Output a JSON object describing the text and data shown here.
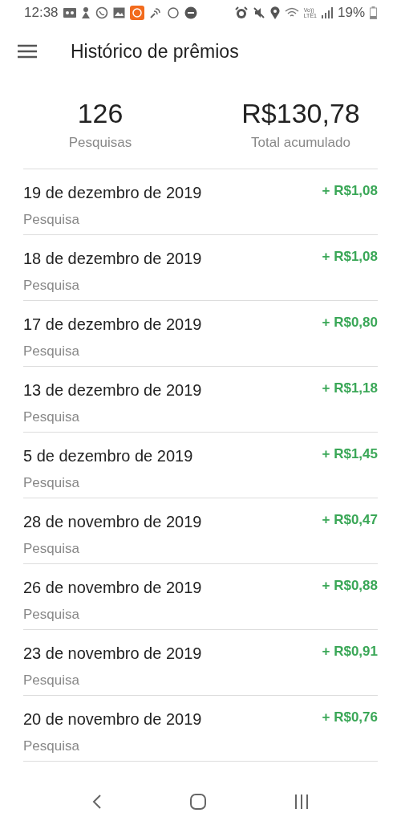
{
  "status_bar": {
    "time": "12:38",
    "volte": "Vo))",
    "network": "LTE1",
    "battery": "19%"
  },
  "header": {
    "title": "Histórico de prêmios"
  },
  "summary": [
    {
      "value": "126",
      "label": "Pesquisas"
    },
    {
      "value": "R$130,78",
      "label": "Total acumulado"
    }
  ],
  "rewards": [
    {
      "date": "19 de dezembro de 2019",
      "type": "Pesquisa",
      "amount": "+ R$1,08"
    },
    {
      "date": "18 de dezembro de 2019",
      "type": "Pesquisa",
      "amount": "+ R$1,08"
    },
    {
      "date": "17 de dezembro de 2019",
      "type": "Pesquisa",
      "amount": "+ R$0,80"
    },
    {
      "date": "13 de dezembro de 2019",
      "type": "Pesquisa",
      "amount": "+ R$1,18"
    },
    {
      "date": "5 de dezembro de 2019",
      "type": "Pesquisa",
      "amount": "+ R$1,45"
    },
    {
      "date": "28 de novembro de 2019",
      "type": "Pesquisa",
      "amount": "+ R$0,47"
    },
    {
      "date": "26 de novembro de 2019",
      "type": "Pesquisa",
      "amount": "+ R$0,88"
    },
    {
      "date": "23 de novembro de 2019",
      "type": "Pesquisa",
      "amount": "+ R$0,91"
    },
    {
      "date": "20 de novembro de 2019",
      "type": "Pesquisa",
      "amount": "+ R$0,76"
    }
  ]
}
